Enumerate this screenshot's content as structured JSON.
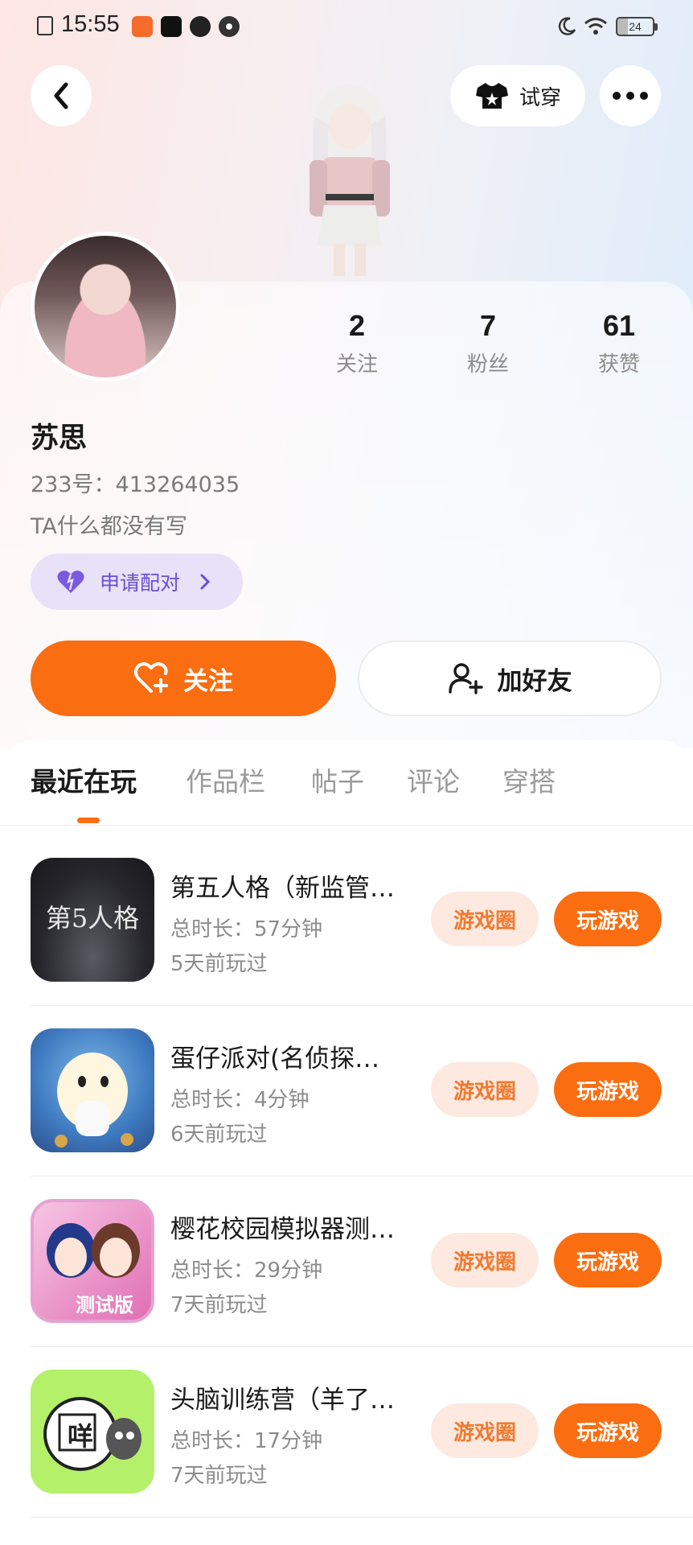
{
  "status_bar": {
    "time": "15:55",
    "battery": "24"
  },
  "header": {
    "tryon_label": "试穿"
  },
  "profile": {
    "name": "苏思",
    "id_line": "233号：413264035",
    "bio": "TA什么都没有写",
    "pair_label": "申请配对",
    "stats": [
      {
        "value": "2",
        "label": "关注"
      },
      {
        "value": "7",
        "label": "粉丝"
      },
      {
        "value": "61",
        "label": "获赞"
      }
    ],
    "follow_label": "关注",
    "add_friend_label": "加好友"
  },
  "tabs": [
    {
      "label": "最近在玩",
      "active": true
    },
    {
      "label": "作品栏",
      "active": false
    },
    {
      "label": "帖子",
      "active": false
    },
    {
      "label": "评论",
      "active": false
    },
    {
      "label": "穿搭",
      "active": false
    }
  ],
  "games": [
    {
      "title": "第五人格（新监管…",
      "duration": "总时长：57分钟",
      "last_played": "5天前玩过",
      "icon": "identity-v-icon",
      "icon_text": "第5人格"
    },
    {
      "title": "蛋仔派对(名侦探…",
      "duration": "总时长：4分钟",
      "last_played": "6天前玩过",
      "icon": "eggy-party-icon"
    },
    {
      "title": "樱花校园模拟器测…",
      "duration": "总时长：29分钟",
      "last_played": "7天前玩过",
      "icon": "sakura-school-icon",
      "icon_text": "测试版"
    },
    {
      "title": "头脑训练营（羊了…",
      "duration": "总时长：17分钟",
      "last_played": "7天前玩过",
      "icon": "sheep-game-icon",
      "icon_text": "咩"
    }
  ],
  "game_buttons": {
    "circle_label": "游戏圈",
    "play_label": "玩游戏"
  },
  "colors": {
    "accent": "#fa6d10",
    "pair_bg": "#e8e1f8",
    "pair_text": "#6a4fd4",
    "circle_bg": "#fde9df"
  }
}
